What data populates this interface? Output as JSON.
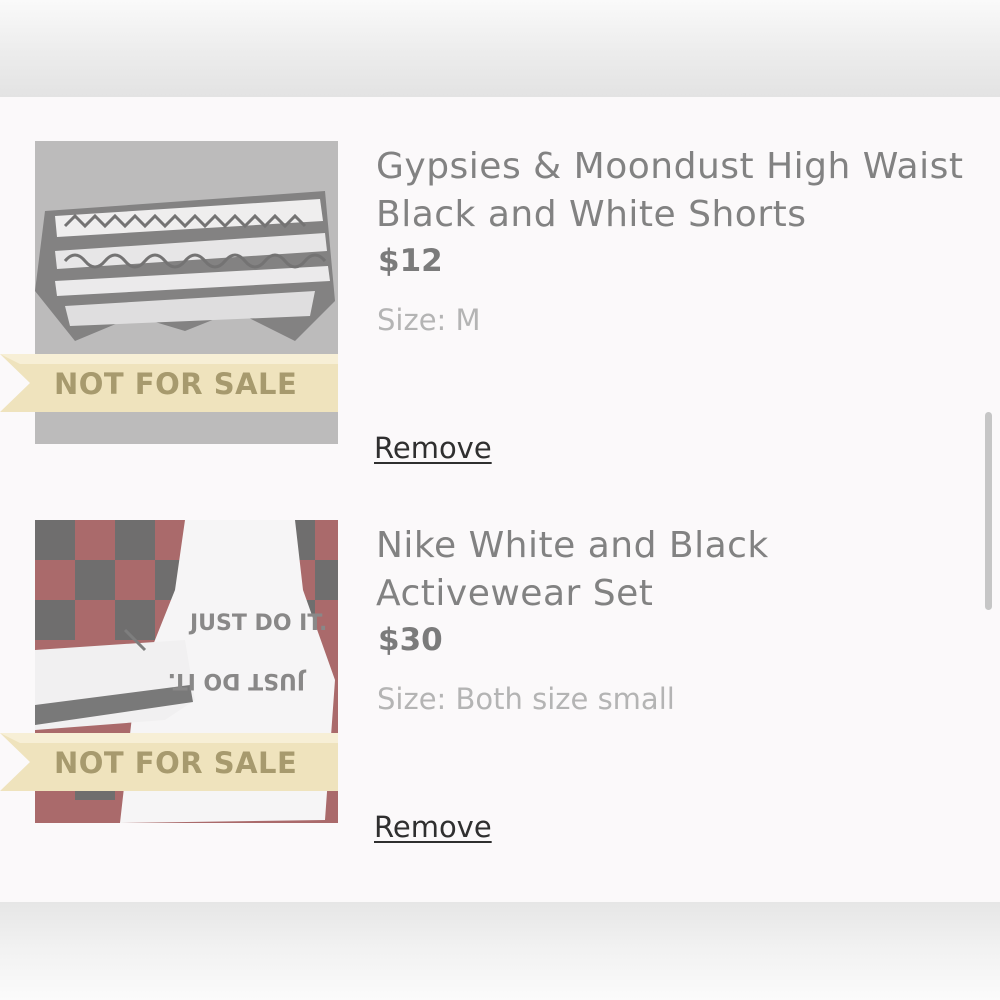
{
  "items": [
    {
      "title_line1": "Gypsies & Moondust High Waist",
      "title_line2": "Black and White Shorts",
      "price": "$12",
      "size": "Size: M",
      "badge": "NOT FOR SALE",
      "remove_label": "Remove"
    },
    {
      "title_line1": "Nike White and Black",
      "title_line2": "Activewear Set",
      "price": "$30",
      "size": "Size: Both size small",
      "badge": "NOT FOR SALE",
      "remove_label": "Remove"
    }
  ],
  "colors": {
    "ribbon": "#efe3bd",
    "badge_text": "#a79a6e",
    "link": "#2f2f2f"
  }
}
